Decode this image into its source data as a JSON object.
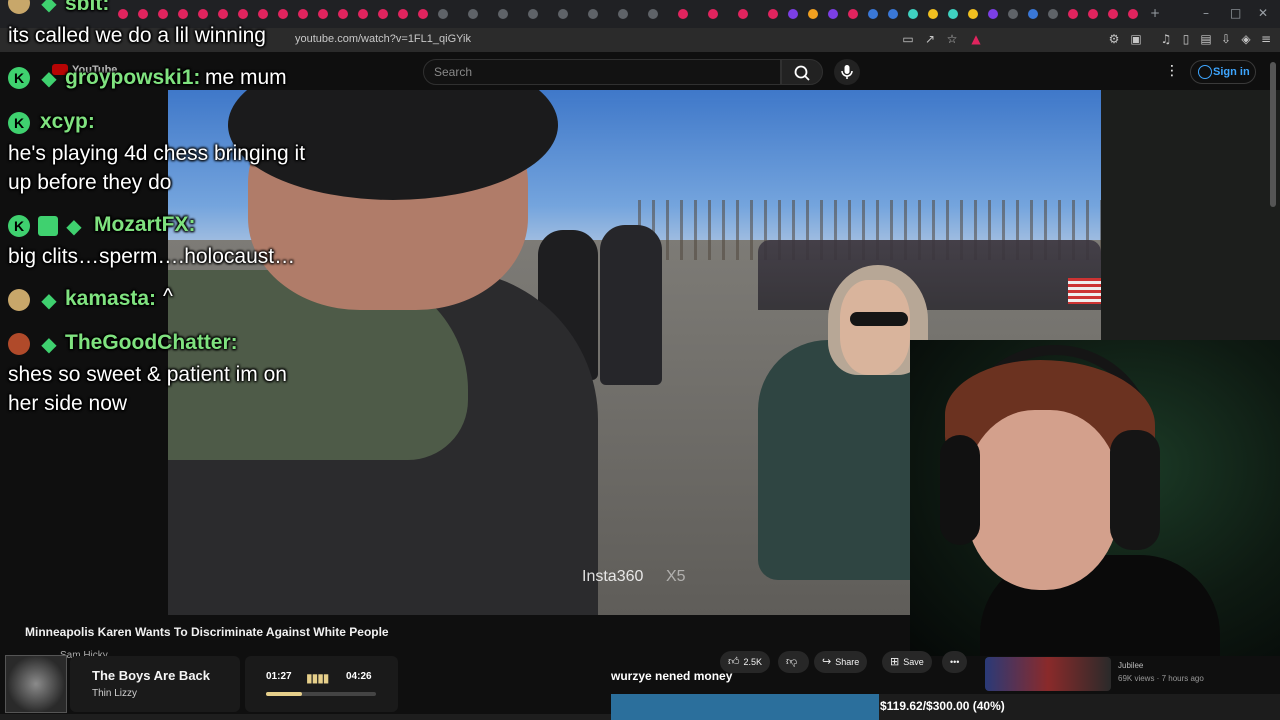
{
  "browser": {
    "url": "youtube.com/watch?v=1FL1_qiGYik"
  },
  "youtube": {
    "logo_text": "YouTube",
    "search_placeholder": "Search",
    "signin_label": "Sign in",
    "video_title": "Minneapolis Karen Wants To Discriminate Against White People",
    "channel_name": "Sam Hicky",
    "like_count": "2.5K",
    "share_label": "Share",
    "save_label": "Save",
    "video_watermark": "Insta360",
    "video_watermark_model": "X5",
    "related": {
      "channel": "Jubilee",
      "meta": "69K views · 7 hours ago"
    }
  },
  "chat": {
    "messages": [
      {
        "user": "sbit:",
        "text": "its called we do a lil winning"
      },
      {
        "user": "groypowski1:",
        "text": "me mum"
      },
      {
        "user": "xcyp:",
        "text": "he's playing 4d chess bringing it",
        "text2": "up before they do"
      },
      {
        "user": "MozartFX:",
        "text": "big clits…sperm….holocaust…"
      },
      {
        "user": "kamasta:",
        "text": "^"
      },
      {
        "user": "TheGoodChatter:",
        "text": "shes so sweet & patient im on",
        "text2": "her side now"
      }
    ]
  },
  "music": {
    "title": "The Boys Are Back",
    "artist": "Thin Lizzy",
    "elapsed": "01:27",
    "duration": "04:26",
    "progress_fraction": 0.33
  },
  "goal": {
    "label": "wurzye nened money",
    "text": "$119.62/$300.00 (40%)",
    "fraction": 0.4
  },
  "colors": {
    "chat_name": "#7fe27f",
    "badge_green": "#3fd16f",
    "yt_link": "#3ea6ff",
    "goal_fill": "#2b6f9c",
    "music_accent": "#e6cf8a"
  }
}
